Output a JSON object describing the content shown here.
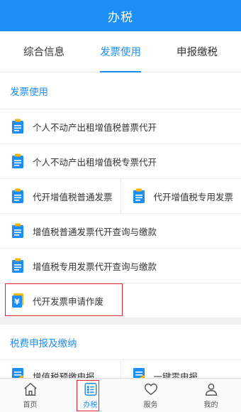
{
  "header": {
    "title": "办税"
  },
  "tabs": [
    {
      "label": "综合信息"
    },
    {
      "label": "发票使用"
    },
    {
      "label": "申报缴税"
    }
  ],
  "invoice_section": {
    "title": "发票使用",
    "rows": [
      {
        "label": "个人不动产出租增值税普票代开"
      },
      {
        "label": "个人不动产出租增值税专票代开"
      },
      {
        "left_label": "代开增值税普通发票",
        "right_label": "代开增值税专用发票"
      },
      {
        "label": "增值税普通发票代开查询与缴款"
      },
      {
        "label": "增值税专用发票代开查询与缴款"
      },
      {
        "label": "代开发票申请作废"
      }
    ]
  },
  "tax_section": {
    "title": "税费申报及缴纳",
    "left_label": "增值税预缴申报",
    "right_label": "一键零申报"
  },
  "tabbar": [
    {
      "label": "首页"
    },
    {
      "label": "办税"
    },
    {
      "label": "服务"
    },
    {
      "label": "我的"
    }
  ],
  "colors": {
    "accent": "#1e8ef7",
    "highlight": "#e2282c",
    "icon_gold": "#f5b400"
  }
}
